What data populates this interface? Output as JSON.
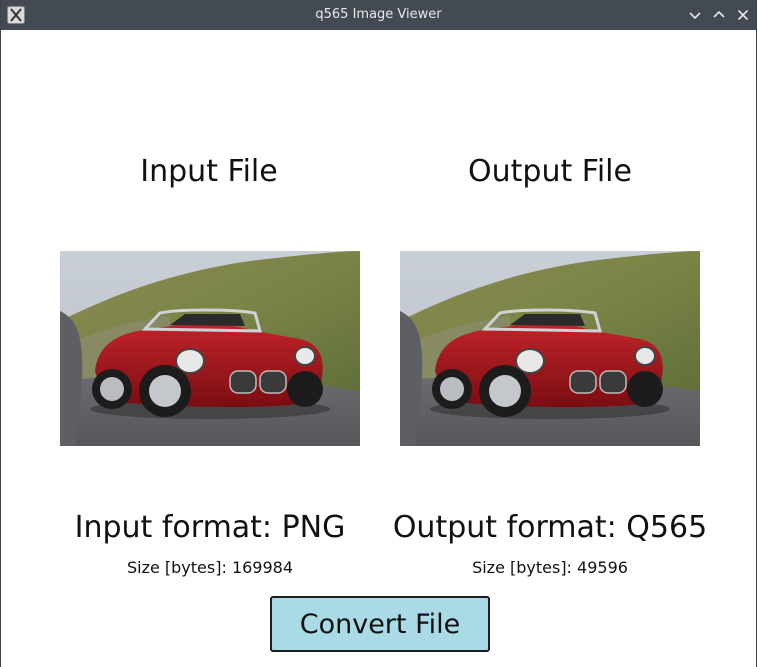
{
  "window": {
    "title": "q565 Image Viewer"
  },
  "input": {
    "heading": "Input File",
    "format_label": "Input format: PNG",
    "size_label": "Size [bytes]: 169984"
  },
  "output": {
    "heading": "Output File",
    "format_label": "Output format: Q565",
    "size_label": "Size [bytes]: 49596"
  },
  "actions": {
    "convert_label": "Convert File"
  },
  "colors": {
    "titlebar": "#444a52",
    "button_bg": "#a9dae6",
    "car_body": "#a5141b"
  },
  "icons": {
    "app": "x-app-icon",
    "minimize": "chevron-down-icon",
    "maximize": "chevron-up-icon",
    "close": "close-icon"
  }
}
